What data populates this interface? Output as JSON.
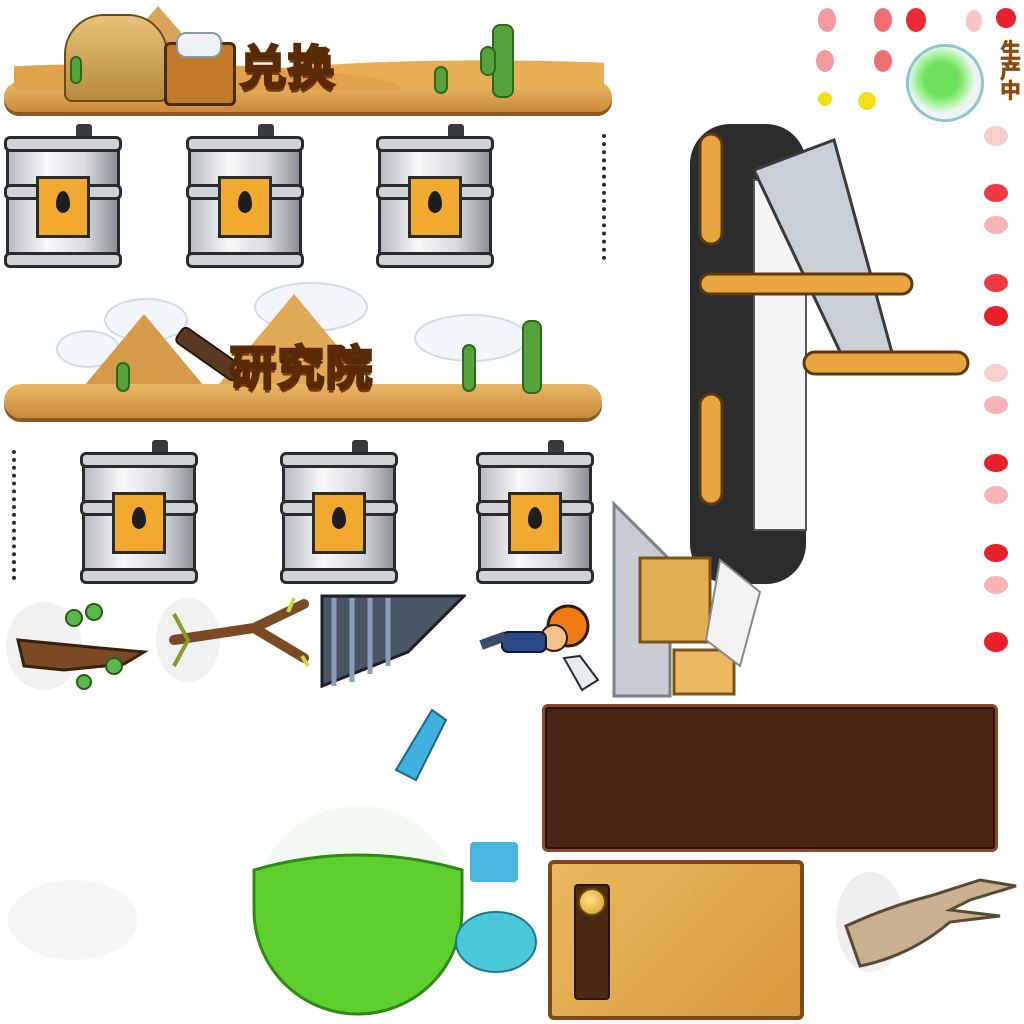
{
  "exchange_banner": {
    "title": "兑换"
  },
  "research_banner": {
    "title": "研究院"
  },
  "status_label": {
    "text": "生产中"
  },
  "colors": {
    "sand": "#d9a35a",
    "title_orange": "#ffb12b",
    "panel_brown": "#4a2414",
    "liquid_green": "#5fcf2e",
    "status_red": "#e8202a"
  },
  "icons": [
    "sphinx-icon",
    "treasure-chest-icon",
    "telescope-icon",
    "oil-barrel-icon",
    "branch-icon",
    "miner-icon",
    "potion-flask-icon",
    "driftwood-icon",
    "conveyor-icon"
  ]
}
